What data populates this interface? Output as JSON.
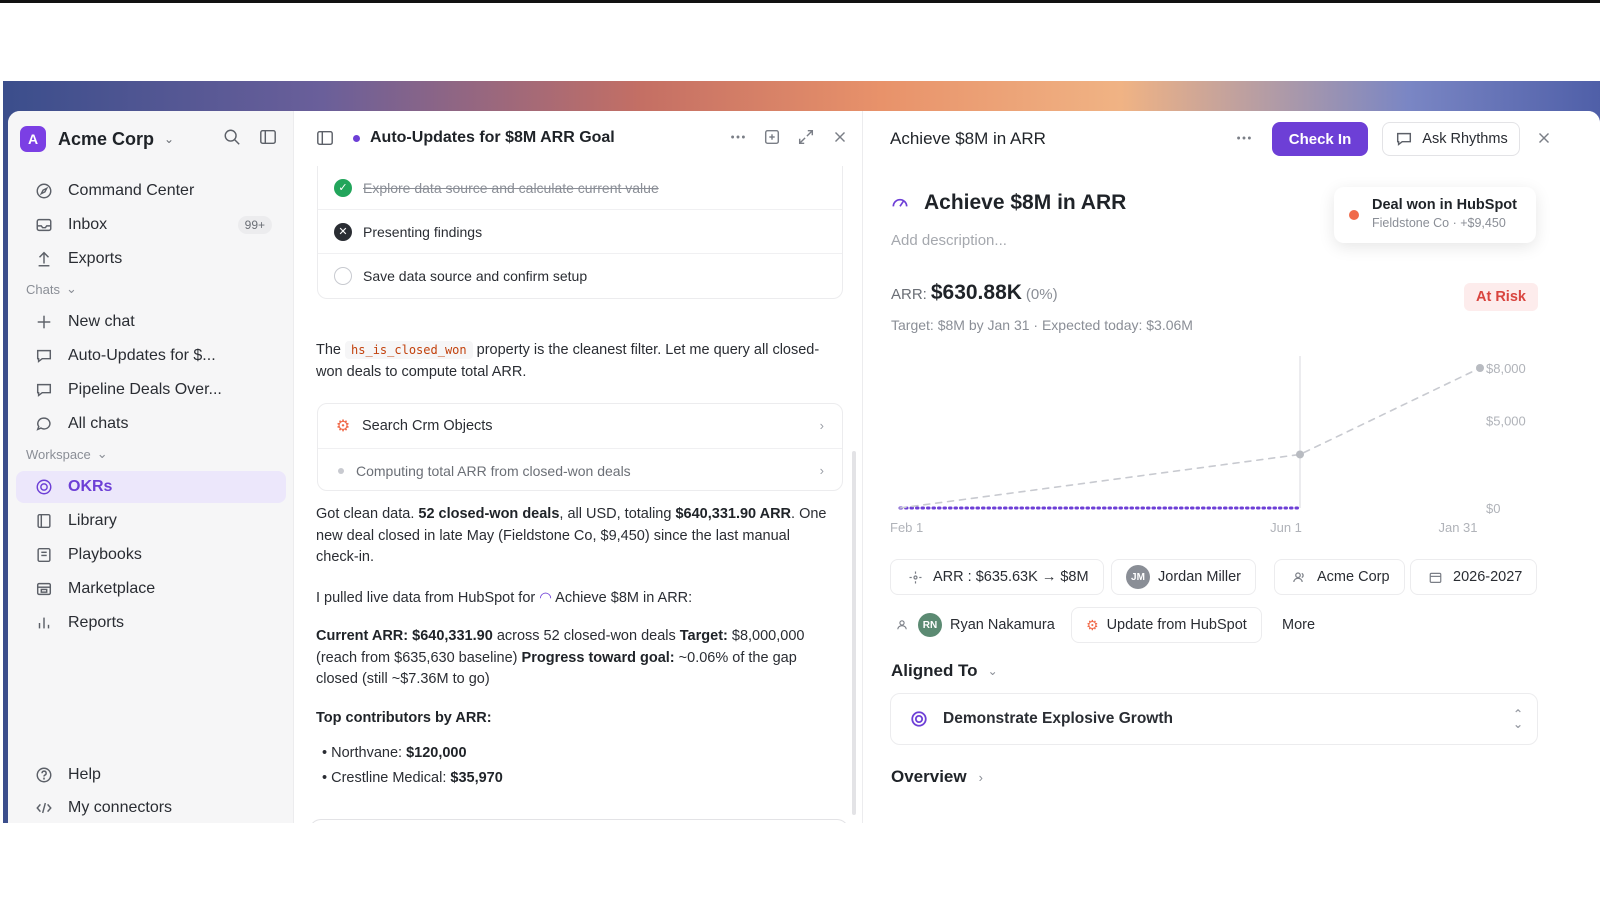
{
  "workspace": {
    "initial": "A",
    "name": "Acme Corp"
  },
  "sidebar": {
    "top_items": [
      {
        "label": "Command Center",
        "icon": "compass-icon"
      },
      {
        "label": "Inbox",
        "icon": "inbox-icon",
        "badge": "99+"
      },
      {
        "label": "Exports",
        "icon": "upload-icon"
      }
    ],
    "chats_label": "Chats",
    "chat_items": [
      {
        "label": "New chat",
        "icon": "plus-icon"
      },
      {
        "label": "Auto-Updates for $...",
        "icon": "chat-bubble-icon"
      },
      {
        "label": "Pipeline Deals Over...",
        "icon": "chat-bubble-icon"
      },
      {
        "label": "All chats",
        "icon": "chat-bubble-icon"
      }
    ],
    "workspace_label": "Workspace",
    "workspace_items": [
      {
        "label": "OKRs",
        "icon": "target-icon",
        "active": true
      },
      {
        "label": "Library",
        "icon": "book-icon"
      },
      {
        "label": "Playbooks",
        "icon": "playbook-icon"
      },
      {
        "label": "Marketplace",
        "icon": "store-icon"
      },
      {
        "label": "Reports",
        "icon": "bar-chart-icon"
      }
    ],
    "bottom_items": [
      {
        "label": "Help",
        "icon": "help-icon"
      },
      {
        "label": "My connectors",
        "icon": "code-icon"
      }
    ]
  },
  "chat_panel": {
    "title": "Auto-Updates for $8M ARR Goal",
    "steps": [
      {
        "label": "Explore data source and calculate current value",
        "state": "done"
      },
      {
        "label": "Presenting findings",
        "state": "failed"
      },
      {
        "label": "Save data source and confirm setup",
        "state": "todo"
      }
    ],
    "msg1_a": "The",
    "msg1_code": "hs_is_closed_won",
    "msg1_b": "property is the cleanest filter. Let me query all closed-won deals to compute total ARR.",
    "tool_name": "Search Crm Objects",
    "tool_sub": "Computing total ARR from closed-won deals",
    "msg2_a": "Got clean data.",
    "msg2_b": "52 closed-won deals",
    "msg2_c": ", all USD, totaling",
    "msg2_d": "$640,331.90 ARR",
    "msg2_e": ". One new deal closed in late May (Fieldstone Co, $9,450) since the last manual check-in.",
    "msg3_a": "I pulled live data from HubSpot for",
    "msg3_b": "Achieve $8M in ARR:",
    "msg4_l1": "Current ARR:",
    "msg4_v1": "$640,331.90",
    "msg4_t1": "across 52 closed-won deals",
    "msg4_l2": "Target:",
    "msg4_t2": "$8,000,000 (reach from $635,630 baseline)",
    "msg4_l3": "Progress toward goal:",
    "msg4_t3": "~0.06% of the gap closed (still ~$7.36M to go)",
    "contributors_heading": "Top contributors by ARR:",
    "contributors": [
      {
        "name": "Northvane:",
        "value": "$120,000"
      },
      {
        "name": "Crestline Medical:",
        "value": "$35,970"
      }
    ]
  },
  "goal_panel": {
    "header_title": "Achieve $8M in ARR",
    "checkin_label": "Check In",
    "ask_label": "Ask Rhythms",
    "title": "Achieve $8M in ARR",
    "description_placeholder": "Add description...",
    "toast_title": "Deal won in HubSpot",
    "toast_sub": "Fieldstone Co · +$9,450",
    "arr_label": "ARR:",
    "arr_value": "$630.88K",
    "arr_pct": "(0%)",
    "status": "At Risk",
    "target_line": "Target: $8M by Jan 31 · Expected today: $3.06M",
    "chips_row1": [
      {
        "label": "ARR : $635.63K → $8M",
        "icon": "sparkle-icon"
      },
      {
        "label": "Jordan Miller",
        "avatar": "JM"
      },
      {
        "label": "Acme Corp",
        "icon": "team-icon"
      },
      {
        "label": "2026-2027",
        "icon": "calendar-icon"
      }
    ],
    "chips_row2": [
      {
        "label": "Ryan Nakamura",
        "avatar": "RN"
      },
      {
        "label": "Update from HubSpot",
        "icon": "hubspot-icon"
      },
      {
        "label": "More"
      }
    ],
    "aligned_label": "Aligned To",
    "aligned_item": "Demonstrate Explosive Growth",
    "overview_label": "Overview"
  },
  "chart_data": {
    "type": "line",
    "x_ticks": [
      "Feb 1",
      "Jun 1",
      "Jan 31"
    ],
    "y_ticks": [
      "$0",
      "$5,000",
      "$8,000"
    ],
    "ylim": [
      0,
      8000
    ],
    "series": [
      {
        "values": [
          {
            "x": "Feb 1",
            "y": 0
          },
          {
            "x": "Jun 1",
            "y": 0
          }
        ],
        "color": "#6d3fd6",
        "style": "dotted"
      },
      {
        "values": [
          {
            "x": "Feb 1",
            "y": 0
          },
          {
            "x": "Jun 1",
            "y": 3060
          },
          {
            "x": "Jan 31",
            "y": 8000
          }
        ],
        "color": "#c8cad0",
        "style": "dashed"
      }
    ],
    "today_marker": "Jun 1"
  },
  "colors": {
    "accent": "#6d3fd6",
    "at_risk": "#d9453f",
    "done": "#22a55b"
  }
}
